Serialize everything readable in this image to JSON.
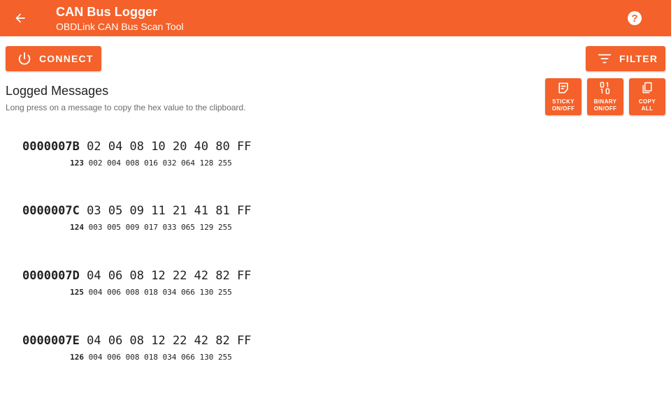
{
  "appbar": {
    "title": "CAN Bus Logger",
    "subtitle": "OBDLink CAN Bus Scan Tool",
    "back_icon": "arrow-left-icon",
    "help_icon": "help-circle-icon",
    "background": "#f4612a"
  },
  "toolbar": {
    "connect_label": "CONNECT",
    "connect_icon": "power-icon",
    "filter_label": "FILTER",
    "filter_icon": "filter-icon"
  },
  "section": {
    "title": "Logged Messages",
    "hint": "Long press on a message to copy the hex value to the clipboard."
  },
  "actions": [
    {
      "line1": "STICKY",
      "line2": "ON/OFF",
      "icon": "sticky-note-icon"
    },
    {
      "line1": "BINARY",
      "line2": "ON/OFF",
      "icon": "binary-icon"
    },
    {
      "line1": "COPY",
      "line2": "ALL",
      "icon": "copy-icon"
    }
  ],
  "messages": [
    {
      "id": "0000007B",
      "hex": "02 04 08 10 20 40 80 FF",
      "dec_id": "123",
      "dec": "002 004 008 016 032 064 128 255"
    },
    {
      "id": "0000007C",
      "hex": "03 05 09 11 21 41 81 FF",
      "dec_id": "124",
      "dec": "003 005 009 017 033 065 129 255"
    },
    {
      "id": "0000007D",
      "hex": "04 06 08 12 22 42 82 FF",
      "dec_id": "125",
      "dec": "004 006 008 018 034 066 130 255"
    },
    {
      "id": "0000007E",
      "hex": "04 06 08 12 22 42 82 FF",
      "dec_id": "126",
      "dec": "004 006 008 018 034 066 130 255"
    }
  ]
}
